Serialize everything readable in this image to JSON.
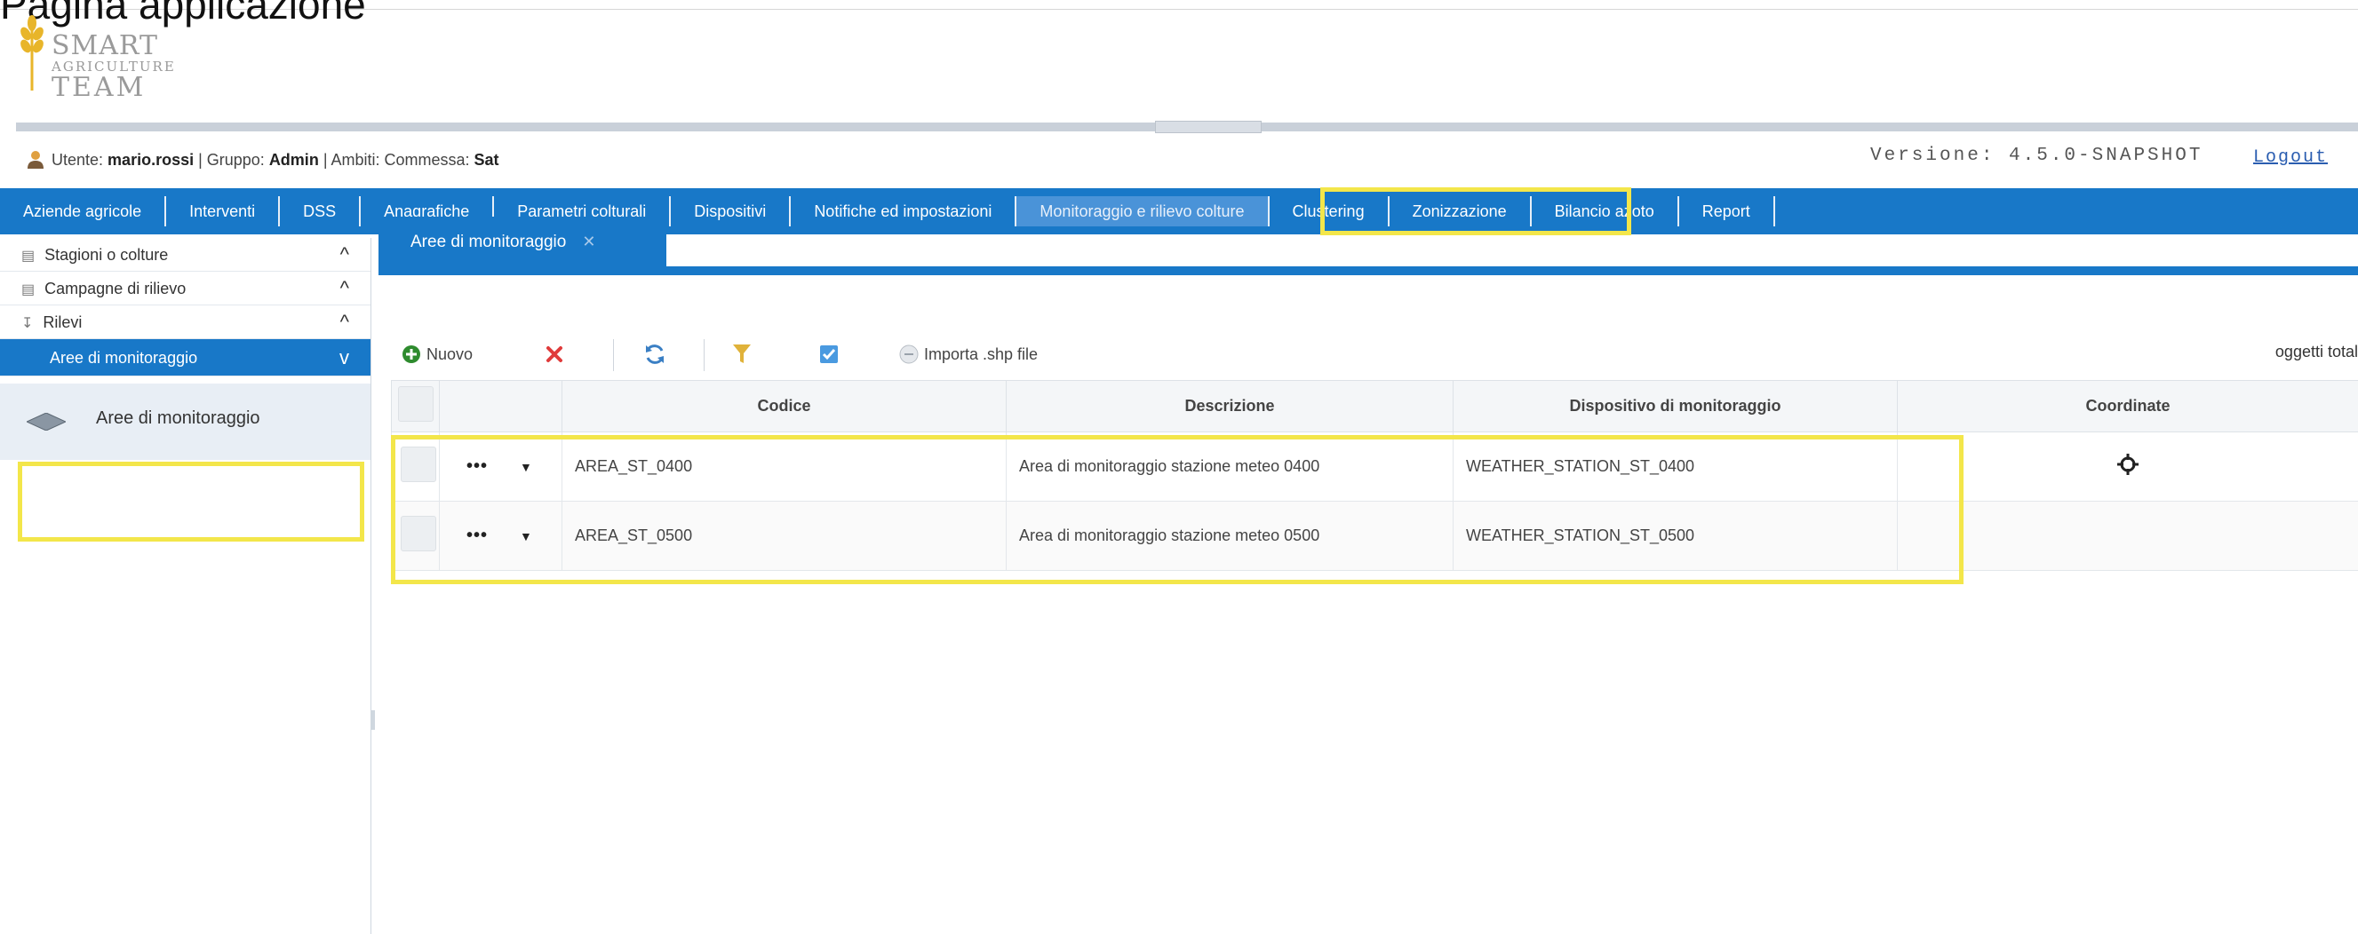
{
  "top_caption": "Pagina applicazione",
  "logo": {
    "line1": "SMART",
    "line2": "AGRICULTURE",
    "line3": "TEAM"
  },
  "userbar": {
    "user_prefix": "Utente: ",
    "user_name": "mario.rossi",
    "group_prefix": " | Gruppo: ",
    "group_name": "Admin",
    "scope_prefix": " | Ambiti: Commessa: ",
    "scope_name": "Sat",
    "version": "Versione: 4.5.0-SNAPSHOT",
    "logout": "Logout"
  },
  "nav": {
    "items": [
      "Aziende agricole",
      "Interventi",
      "DSS",
      "Anagrafiche",
      "Parametri colturali",
      "Dispositivi",
      "Notifiche ed impostazioni",
      "Monitoraggio e rilievo colture",
      "Clustering",
      "Zonizzazione",
      "Bilancio azoto",
      "Report"
    ],
    "active_index": 7
  },
  "sidebar": {
    "items": [
      {
        "label": "Stagioni o colture",
        "icon": "layers-icon",
        "chevron": "^"
      },
      {
        "label": "Campagne di rilievo",
        "icon": "layers-icon",
        "chevron": "^"
      },
      {
        "label": "Rilevi",
        "icon": "download-icon",
        "chevron": "^"
      },
      {
        "label": "Aree di monitoraggio",
        "chevron": "v"
      }
    ],
    "sub_item": "Aree di monitoraggio"
  },
  "tab": {
    "label": "Aree di monitoraggio",
    "close": "✕"
  },
  "toolbar": {
    "new_label": "Nuovo",
    "import_label": "Importa .shp file",
    "total_label": "oggetti total"
  },
  "table": {
    "columns": [
      "Codice",
      "Descrizione",
      "Dispositivo di monitoraggio",
      "Coordinate"
    ],
    "rows": [
      {
        "codice": "AREA_ST_0400",
        "descrizione": "Area di monitoraggio stazione meteo 0400",
        "dispositivo": "WEATHER_STATION_ST_0400",
        "has_coordinates": true
      },
      {
        "codice": "AREA_ST_0500",
        "descrizione": "Area di monitoraggio stazione meteo 0500",
        "dispositivo": "WEATHER_STATION_ST_0500",
        "has_coordinates": false
      }
    ],
    "row_actions": "•••",
    "row_menu": "▼"
  },
  "colors": {
    "nav_blue": "#1878c8",
    "highlight": "#f3e64a",
    "logo_gold": "#e8b52a",
    "delete_red": "#e03b3b",
    "new_green": "#2e8b2e"
  }
}
